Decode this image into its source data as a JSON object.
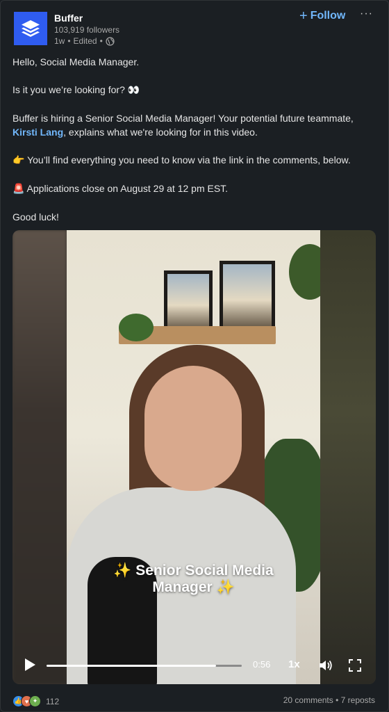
{
  "post": {
    "author_name": "Buffer",
    "followers": "103,919 followers",
    "time": "1w",
    "edited": "Edited",
    "follow_label": "Follow",
    "more_label": "···",
    "lines": {
      "greeting": "Hello, Social Media Manager.",
      "question": "Is it you we’re looking for?",
      "question_emoji": "👀",
      "hiring_pre": "Buffer is hiring a Senior Social Media Manager! Your potential future teammate, ",
      "mention": "Kirsti Lang",
      "hiring_post": ", explains what we're looking for in this video.",
      "link_emoji": "👉",
      "link_text": " You’ll find everything you need to know via the link in the comments, below.",
      "deadline_emoji": "🚨",
      "deadline_text": " Applications close on August 29 at 12 pm EST.",
      "closing": "Good luck!"
    }
  },
  "video": {
    "caption_line1": "Senior Social Media",
    "caption_line2": "Manager",
    "sparkle": "✨",
    "time_remaining": "0:56",
    "speed": "1x",
    "progress": 0.87
  },
  "footer": {
    "reaction_count": "112",
    "comments": "20 comments",
    "separator": " • ",
    "reposts": "7 reposts"
  },
  "colors": {
    "accent": "#71b7fb",
    "brand": "#2f5cf0",
    "background": "#1b1f23"
  }
}
